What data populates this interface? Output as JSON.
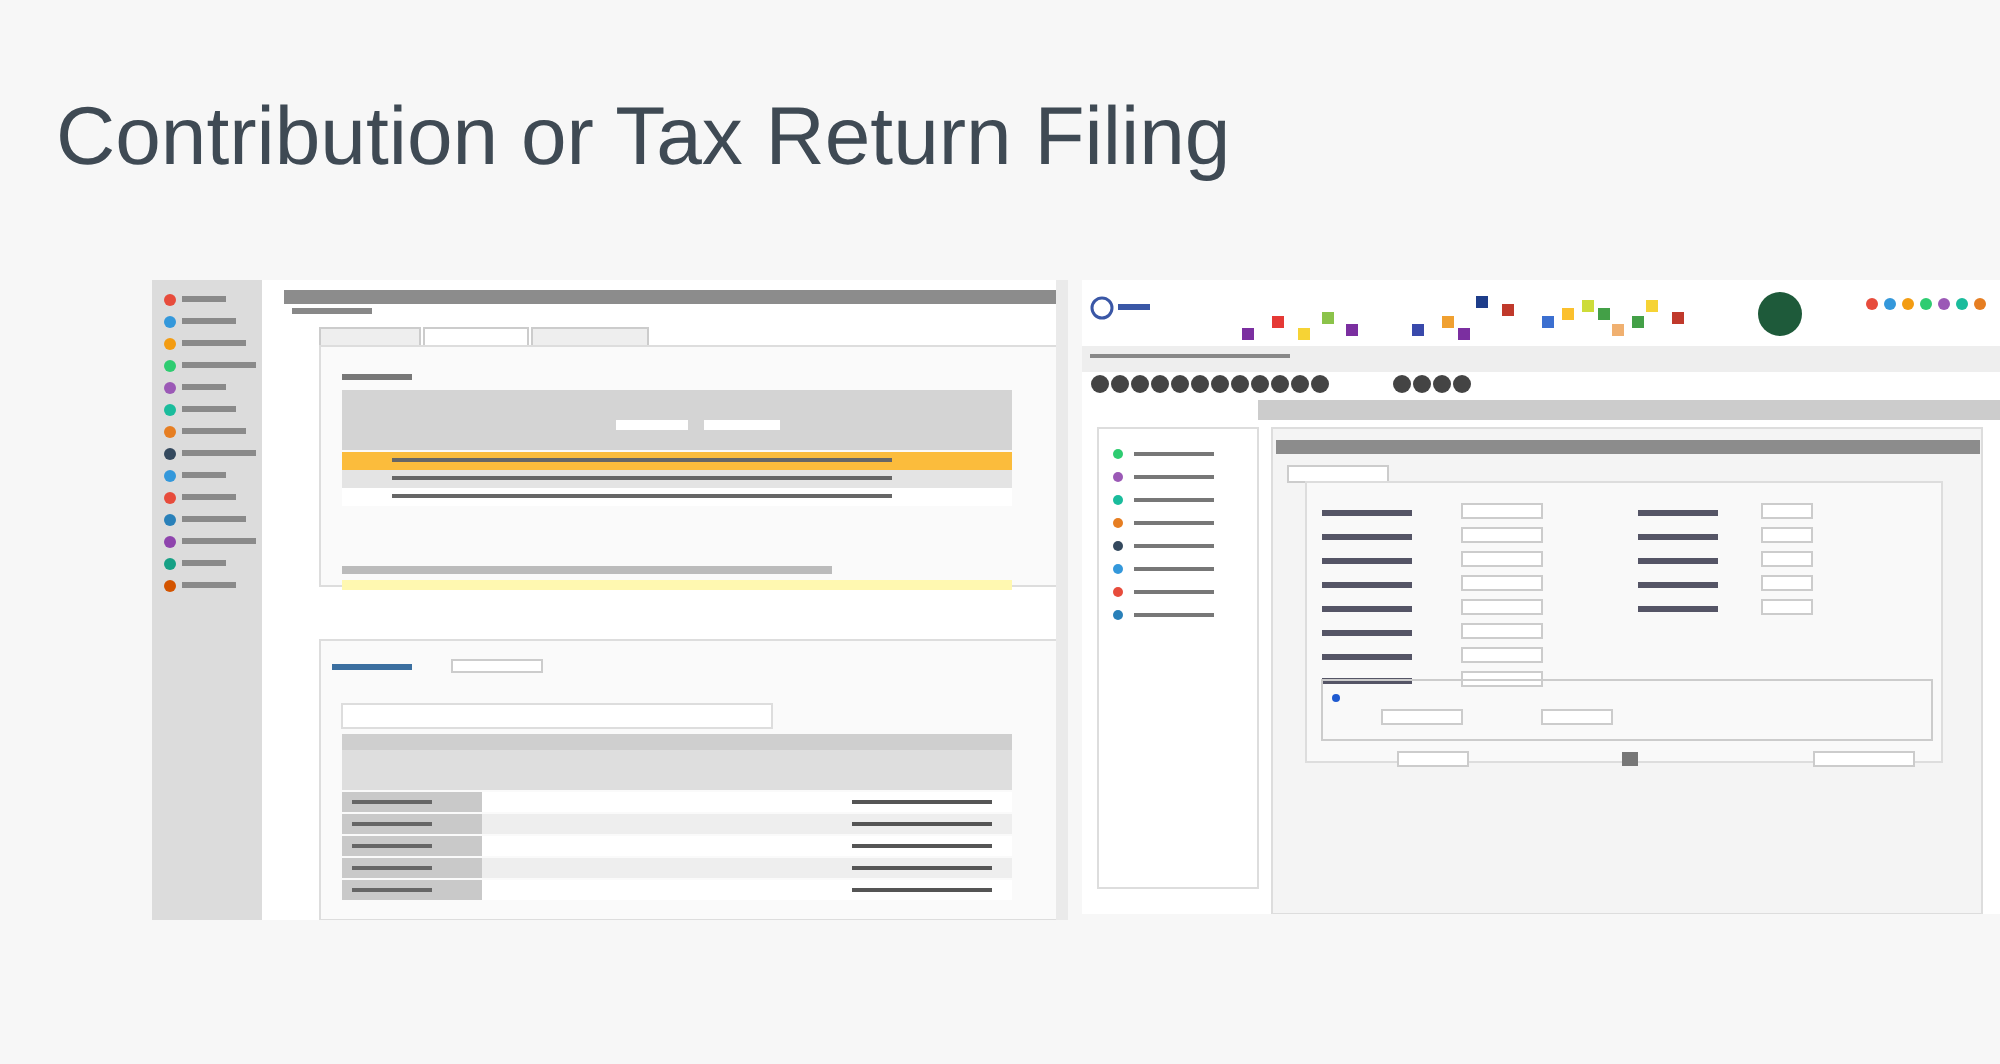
{
  "heading": "Contribution or Tax Return Filing"
}
